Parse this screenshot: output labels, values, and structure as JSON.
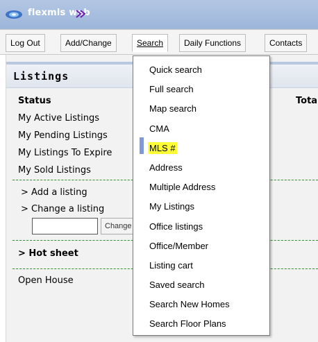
{
  "app": {
    "title_part1": "flexmls",
    "title_part2": "web"
  },
  "menubar": {
    "items": [
      "Log Out",
      "Add/Change",
      "Search",
      "Daily Functions",
      "Contacts"
    ],
    "active": "Search"
  },
  "panel": {
    "title": "Listings",
    "status_label": "Status",
    "total_label": "Tota",
    "status_links": [
      "My Active Listings",
      "My Pending Listings",
      "My Listings To Expire",
      "My Sold Listings"
    ],
    "actions": [
      "> Add a listing",
      "> Change a listing"
    ],
    "change_button": "Change",
    "hot_sheet": "> Hot sheet",
    "open_house": "Open House"
  },
  "search_menu": {
    "items": [
      "Quick search",
      "Full search",
      "Map search",
      "CMA",
      "MLS #",
      "Address",
      "Multiple Address",
      "My Listings",
      "Office listings",
      "Office/Member",
      "Listing cart",
      "Saved search",
      "Search New Homes",
      "Search Floor Plans"
    ],
    "highlighted": "MLS #"
  },
  "colors": {
    "highlight": "#ffff33",
    "dashed_separator": "#2f8f2f",
    "marker": "#7e9ad4"
  }
}
